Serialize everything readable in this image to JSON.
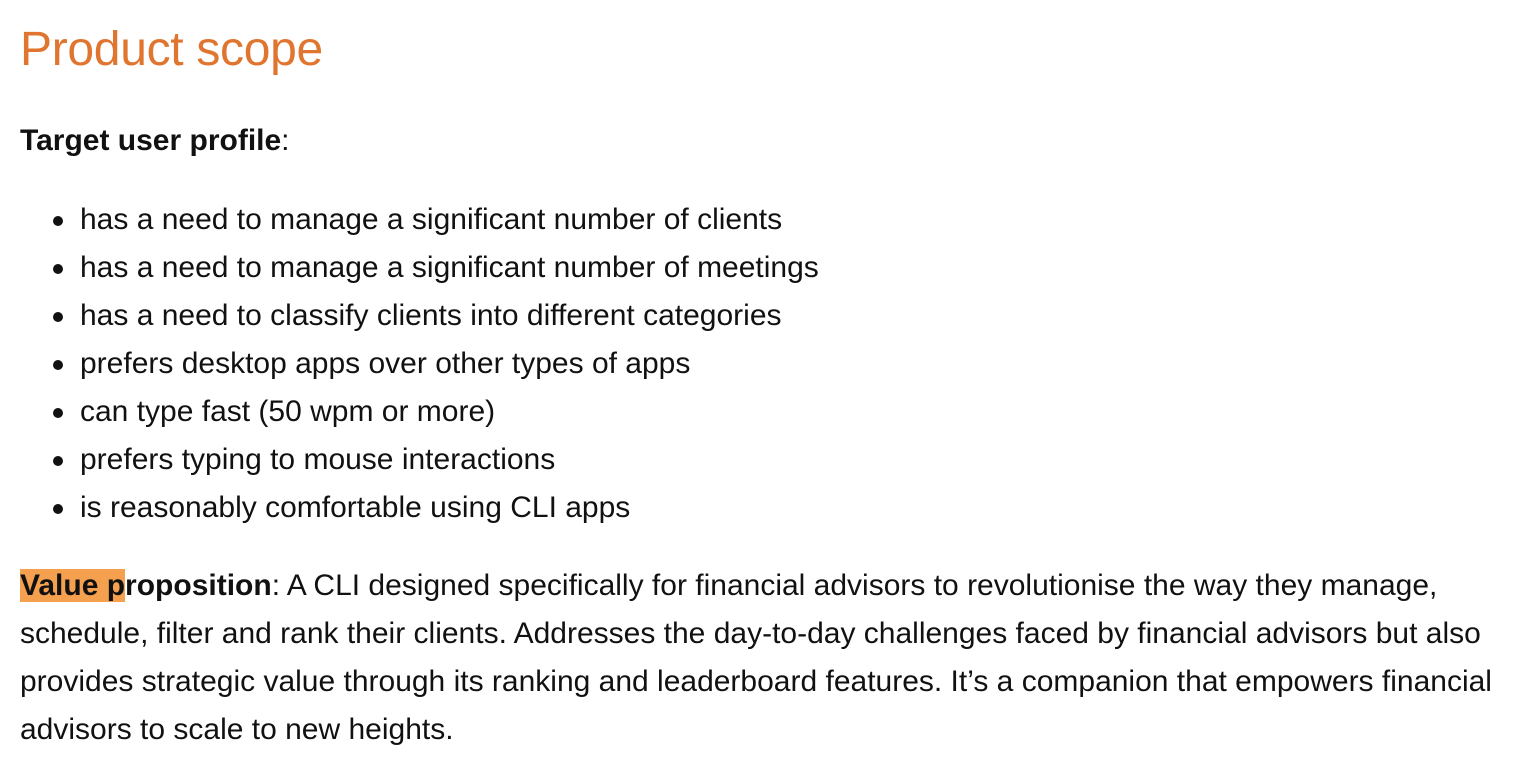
{
  "heading": "Product scope",
  "target_profile": {
    "label": "Target user profile",
    "suffix": ":"
  },
  "profile_items": [
    "has a need to manage a significant number of clients",
    "has a need to manage a significant number of meetings",
    "has a need to classify clients into different categories",
    "prefers desktop apps over other types of apps",
    "can type fast (50 wpm or more)",
    "prefers typing to mouse interactions",
    "is reasonably comfortable using CLI apps"
  ],
  "value_proposition": {
    "label_highlighted": "Value p",
    "label_rest": "roposition",
    "body": ": A CLI designed specifically for financial advisors to revolutionise the way they manage, schedule, filter and rank their clients. Addresses the day-to-day challenges faced by financial advisors but also provides strategic value through its ranking and leaderboard features. It’s a companion that empowers financial advisors to scale to new heights."
  },
  "colors": {
    "heading": "#e0752f",
    "highlight": "#f5a04e",
    "text": "#111111"
  }
}
